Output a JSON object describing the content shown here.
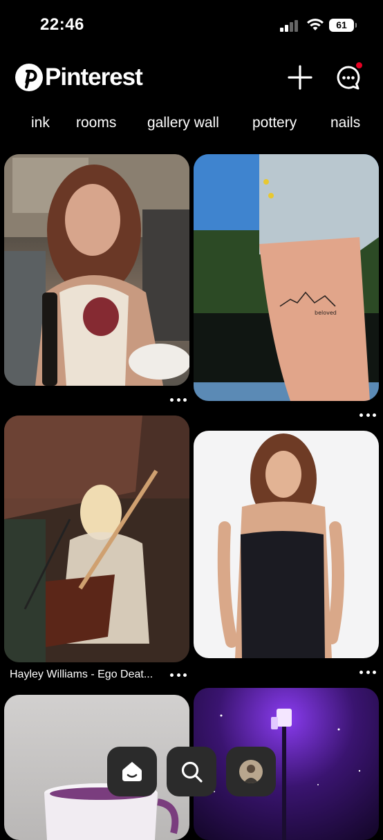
{
  "status": {
    "time": "22:46",
    "battery": "61"
  },
  "header": {
    "brand": "Pinterest",
    "add_icon": "plus-icon",
    "messages_icon": "chat-bubble-icon"
  },
  "topics": [
    "ink",
    "rooms",
    "gallery wall",
    "pottery",
    "nails"
  ],
  "pins": [
    {
      "image": "woman-smiling-with-wine-glass"
    },
    {
      "image": "thigh-tattoo-mountains-beloved",
      "tattoo_text": "beloved"
    },
    {
      "image": "hayley-williams-performing-guitar",
      "title": "Hayley Williams - Ego Deat..."
    },
    {
      "image": "woman-in-black-dress"
    },
    {
      "image": "mug-on-table"
    },
    {
      "image": "purple-night-street-lamp"
    }
  ],
  "nav": {
    "home_icon": "home-icon",
    "search_icon": "search-icon",
    "profile_icon": "profile-avatar"
  },
  "colors": {
    "background": "#000000",
    "accent": "#e60023",
    "nav_button": "#2b2b2b"
  }
}
